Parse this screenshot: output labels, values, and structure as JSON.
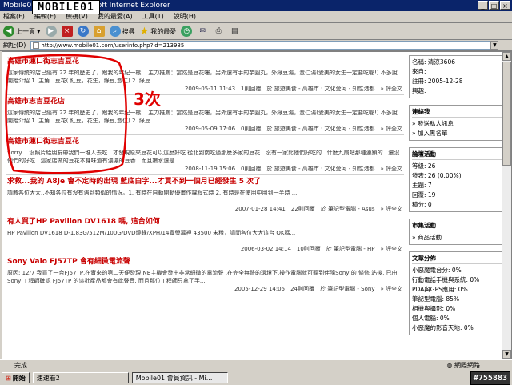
{
  "window": {
    "title": "Mobile01 會員資訊 - Microsoft Internet Explorer",
    "logo_text": "MOBILE01"
  },
  "menu": [
    "檔案(F)",
    "編輯(E)",
    "檢視(V)",
    "我的最愛(A)",
    "工具(T)",
    "說明(H)"
  ],
  "toolbar": {
    "back": "上一頁",
    "search": "搜尋",
    "favorites": "我的最愛"
  },
  "address": {
    "label": "網址(D)",
    "url": "http://www.mobile01.com/userinfo.php?id=213985"
  },
  "annotation": {
    "text": "3次",
    "color": "#e00000"
  },
  "posts": [
    {
      "title": "高雄市蓮口街志吉豆花",
      "desc": "這家傳統的店已經有 22 年的歷史了，跟我的年紀一樣... 主力推薦：當然是豆花嘍，另外還有手的芋圓丸，外綠豆湯，薏仁湯(愛美的女生一定要吃喔!) 不多說...開始介紹 1. 主角...豆花( 紅豆，花生，綠豆,薏仁) 2. 綠豆...",
      "meta": "2009-05-11 11:43　1則回覆　於 旅遊美食 - 高雄市 : 文化愛河 - 知性港都　» 評全文"
    },
    {
      "title": "高雄市志吉豆花店",
      "desc": "這家傳統的店已經有 22 年的歷史了，跟我的年紀一樣... 主力推薦：當然是豆花嘍，另外還有手的芋圓丸，外綠豆湯，薏仁湯(愛美的女生一定要吃喔!) 不多說...開始介紹 1. 主角...豆花( 紅豆，花生，綠豆,薏仁) 2. 綠豆...",
      "meta": "2009-05-09 17:06　0則回覆　於 旅遊美食 - 高雄市 : 文化愛河 - 知性港都　» 評全文"
    },
    {
      "title": "高雄市蓮口街志吉豆花",
      "desc": "Sorry ...沒照片給朋友帶我們一堆人去吃...才發現原來豆花可以這麼好吃 從北到南吃過那麼多家的豆花...沒有一家比他們好吃的...什麼九扇吧那種連鎖的...還沒他們的好吃...這家店做的豆花本身味道有濃濃的豆香...而且嫩水還是...",
      "meta": "2008-11-19 15:06　0則回覆　於 旅遊美食 - 高雄市 : 文化愛河 - 知性港都　» 評全文"
    },
    {
      "title": "求救...我的 A8Je 會不定時的出現 藍底白字...才買不到一個月已經發生 5 次了",
      "desc": "請教各位大大..不知各位有沒有遇到類似的情況。1. 有時在自動開動優畫作課程式時 2. 有時是在使用中用到一半時 ...",
      "meta": "2007-01-28 14:41　22則回覆　於 筆記型電腦 - Asus　» 評全文"
    },
    {
      "title": "有人買了HP Pavilion DV1618 嗎, 這台如何",
      "desc": "HP Pavilion DV1618 D-1.83G/512M/100G/DVD燒錄/XPH/14寬螢幕裡 43500 未稅，請問各位大大這台 OK嗎...",
      "meta": "2006-03-02 14:14　10則回覆　於 筆記型電腦 - HP　» 評全文"
    },
    {
      "title": "Sony Vaio FJ57TP 會有細微電流聲",
      "desc": "原因: 12/7 我買了一台FJ57TP,在實來的第二天便發現 NB主機會發出非常細微的電流聲 ,在完全無聲的環境下,操作電腦就可聽到伴隨Sony 的 條修 站後, 已由Sony 工程師確認 FJ57TP 的這批產品都會有此聲音. 而且那位工程師只拿了手...",
      "meta": "2005-12-29 14:05　24則回覆　於 筆記型電腦 - Sony　» 評全文"
    }
  ],
  "profile": {
    "lines": [
      "名稱: 清涼3606",
      "來自:",
      "註冊: 2005-12-28",
      "興趣:"
    ]
  },
  "contact": {
    "title": "連絡我",
    "items": [
      "» 發送私人訊息",
      "» 加入黑名單"
    ]
  },
  "forum": {
    "title": "論壇活動",
    "lines": [
      "等級: 26",
      "發表: 26 (0.00%)",
      "主題: 7",
      "回覆: 19",
      "積分: 0"
    ]
  },
  "market": {
    "title": "市集活動",
    "items": [
      "» 商品活動"
    ]
  },
  "stats": {
    "title": "文章分佈",
    "lines": [
      "小惡魔電台分: 0%",
      "行動電話手機與系統: 0%",
      "PDA與GPS應用: 0%",
      "筆記型電腦: 85%",
      "相機與攝影: 0%",
      "個人電腦: 0%",
      "小惡魔的影音天地: 0%"
    ]
  },
  "status": {
    "text": "完成",
    "zone": "網際網路"
  },
  "taskbar": {
    "start": "開始",
    "tasks": [
      "速速看2",
      "Mobile01 會員資訊 - Mi..."
    ],
    "clock": "#755883"
  }
}
